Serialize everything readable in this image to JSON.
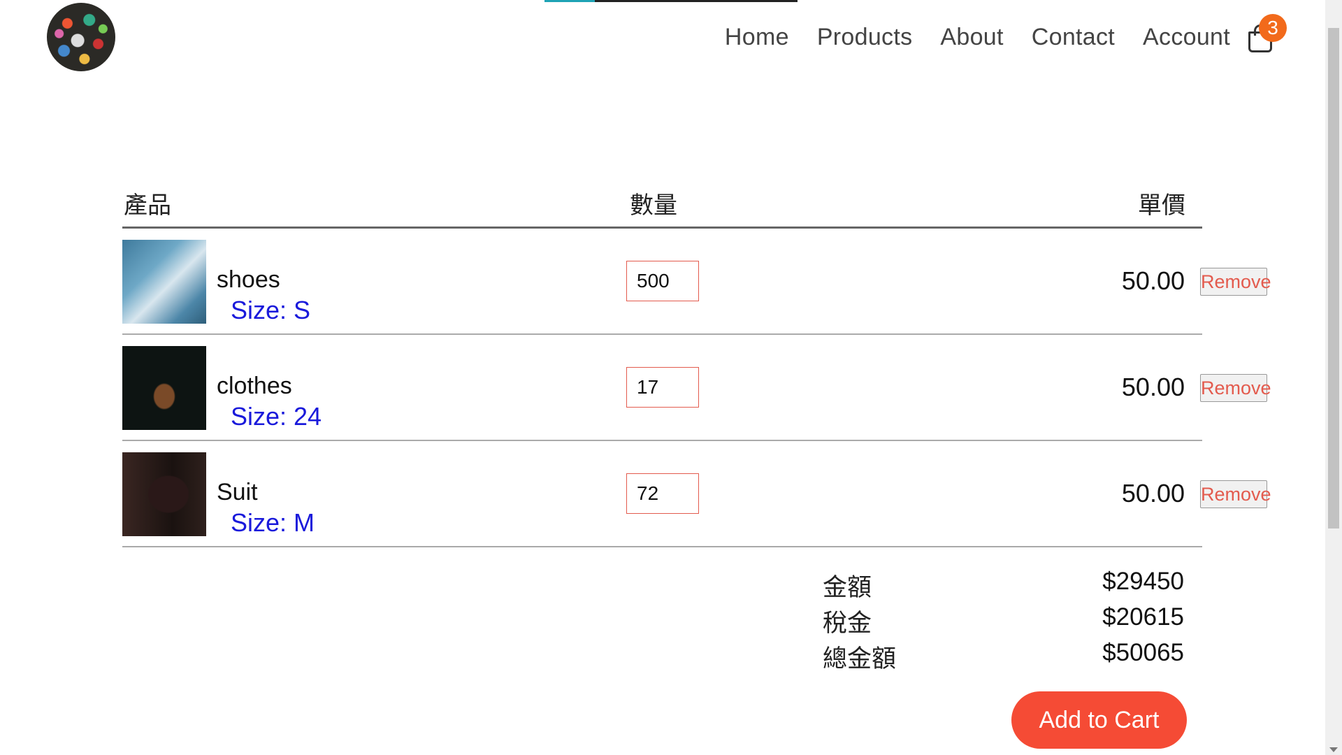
{
  "header": {
    "cart_count": "3",
    "nav": [
      "Home",
      "Products",
      "About",
      "Contact",
      "Account"
    ]
  },
  "table": {
    "headers": {
      "product": "產品",
      "quantity": "數量",
      "unit_price": "單價"
    },
    "items": [
      {
        "name": "shoes",
        "size": "Size: S",
        "quantity": "500",
        "price": "50.00",
        "remove_label": "Remove"
      },
      {
        "name": "clothes",
        "size": "Size: 24",
        "quantity": "17",
        "price": "50.00",
        "remove_label": "Remove"
      },
      {
        "name": "Suit",
        "size": "Size: M",
        "quantity": "72",
        "price": "50.00",
        "remove_label": "Remove"
      }
    ]
  },
  "totals": {
    "subtotal_label": "金額",
    "subtotal": "$29450",
    "tax_label": "稅金",
    "tax": "$20615",
    "total_label": "總金額",
    "total": "$50065"
  },
  "add_to_cart_label": "Add to Cart",
  "colors": {
    "accent": "#f54b35",
    "badge": "#f26a1b",
    "size_text": "#1a1adb",
    "remove_text": "#e35b4e"
  },
  "icons": {
    "cart": "shopping-bag-icon"
  }
}
